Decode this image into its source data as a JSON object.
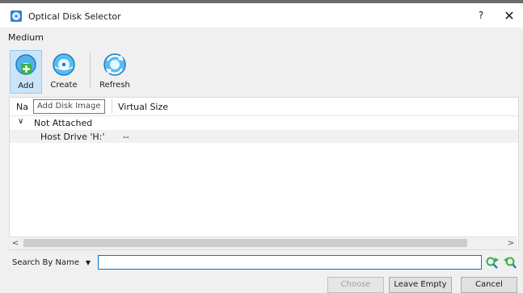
{
  "window": {
    "title": "Optical Disk Selector",
    "help": "?",
    "close": "✕",
    "icon": "optical-disk-icon"
  },
  "section_label": "Medium",
  "toolbar": {
    "add": {
      "label": "Add",
      "icon": "add-disk-icon"
    },
    "create": {
      "label": "Create",
      "icon": "create-disk-icon"
    },
    "refresh": {
      "label": "Refresh",
      "icon": "refresh-icon"
    },
    "tooltip": "Add Disk Image"
  },
  "table": {
    "columns": {
      "name": "Na",
      "virtual_size": "Virtual Size"
    },
    "group": {
      "label": "Not Attached",
      "chevron": "∨"
    },
    "items": [
      {
        "name": "Host Drive 'H:'",
        "virtual_size": "--"
      }
    ]
  },
  "scrollbar": {
    "left_arrow": "<",
    "right_arrow": ">"
  },
  "search": {
    "mode": "Search By Name",
    "value": "",
    "next_icon": "search-forward-icon",
    "prev_icon": "search-backward-icon"
  },
  "buttons": {
    "choose": "Choose",
    "leave_empty": "Leave Empty",
    "cancel": "Cancel"
  },
  "colors": {
    "accent": "#0078d7",
    "icon_green": "#3cb04a",
    "icon_blue": "#2f8fd8",
    "toolbar_highlight": "#cce4f7"
  }
}
